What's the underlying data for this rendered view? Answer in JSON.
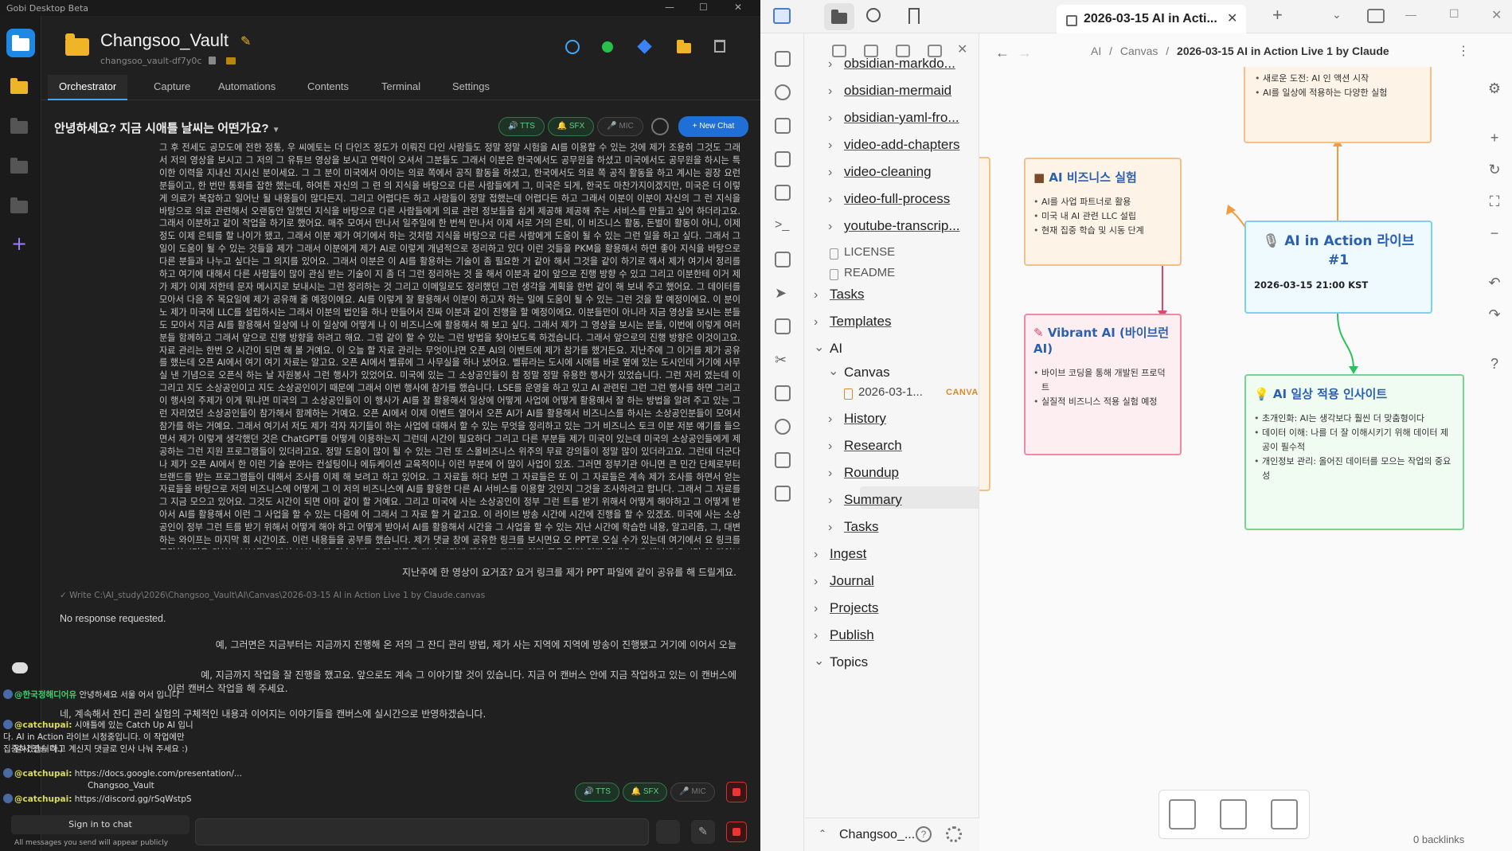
{
  "gobi": {
    "window_title": "Gobi Desktop Beta",
    "vault_name": "Changsoo_Vault",
    "vault_id": "changsoo_vault-df7y0c",
    "tabs": [
      "Orchestrator",
      "Capture",
      "Automations",
      "Contents",
      "Terminal",
      "Settings"
    ],
    "chat_title": "안녕하세요? 지금 시애틀 날씨는 어떤가요?",
    "pills": {
      "tts": "TTS",
      "sfx": "SFX",
      "mic": "MIC",
      "new_chat": "+ New Chat"
    },
    "transcript": "그 후 전세도 공모도에 전한 정통, 우 씨에토는 더 다인즈 정도가 이뤄진 다인 사람들도 정말 정말 시험을 AI를 이용할 수 있는 것에 제가 조용히 그것도 그래서 저의 영상을 보시고 그 저의 그 유튜브 영상을 보시고 연락이 오셔서 그분들도 그래서 이분은 한국에서도 공무원을 하셨고 미국에서도 공무원을 하시는 특이한 이력을 지내신 지시신 분이세요. 그 그 분이 미국에서 아이는 의료 쪽에서 공직 활동을 하셨고, 한국에서도 의료 쪽 공직 활동을 하고 계시는 굉장 요런 분들이고, 한 번만 통화를 잡한 했는데, 하여튼 자신의 그 련 의 지식을 바탕으로 다른 사람들에게 그, 미국은 되게, 한국도 마찬가지이겠지만, 미국은 더 이렇게 의료가 복잡하고 일어난 될 내용들이 많다든지. 그리고 어렵다든 하고 사람들이 정말 접했는데 어렵다든 하고 그래서 이분이 이분이 자신의 그 런 지식을 바탕으로 의료 관련해서 오랜동안 일했던 지식을 바탕으로 다른 사람들에게 의료 관련 정보들을 쉽게 제공해 제공해 주는 서비스를 만들고 싶어 하더라고요. 그래서 이분하고 같이 작업을 하기로 했어요. 매주 모여서 만나서 일주일에 한 번씩 만나서 이제 서로 거의 은퇴, 이 비즈니스 활동, 돈벌이 활동이 아니, 이제 정도 이제 은퇴를 할 나이가 됐고, 그래서 이분 제가 여기에서 하는 것처럼 지식을 바탕으로 다른 사람에게 도움이 될 수 있는 그런 일을 하고 싶다. 그래서 그 일이 도움이 될 수 있는 것들을 제가 그래서 이분에게 제가 AI로 이렇게 개념적으로 정리하고 있다 이런 것들을 PKM을 활용해서 하면 좋아 지식을 바탕으로 다른 분들과 나누고 싶다는 그 의지를 있어요. 그래서 이분은 이 AI를 활용하는 기술이 좀 필요한 거 같아 해서 그것을 같이 하기로 해서 제가 여기서 정리를 하고 여기에 대해서 다른 사람들이 많이 관심 받는 기술이 지 좀 더 그런 정리하는 것 을 해서 이분과 같이 앞으로 진행 방향 수 있고 그리고 이분한테 이거 제가 제가 이제 저한테 문자 메시지로 보내시는 그런 정리하는 것 그리고 이메일로도 정리했던 그런 생각을 계획을 한번 같이 해 보내 주고 했어요. 그 데이터를 모아서 다음 주 목요일에 제가 공유해 줄 예정이에요. AI를 이렇게 잘 활용해서 이분이 하고자 하는 일에 도움이 될 수 있는 그런 것을 할 예정이에요. 이 분이 노 제가 미국에 LLC를 설립하시는 그래서 이분의 법인을 하나 만들어서 진짜 이분과 같이 진행을 할 예정이에요. 이분들만이 아니라 지금 영상을 보시는 분들도 모아서 지금 AI를 활용해서 일상에 나 이 일상에 어떻게 나 이 비즈니스에 활용해서 해 보고 싶다. 그래서 제가 그 영상을 보시는 분들, 이번에 이렇게 여러분들 함께하고 그래서 앞으로 진행 방향을 하려고 해요. 그럼 같이 할 수 있는 그런 방법을 찾아보도록 하겠습니다. 그래서 앞으로의 진행 방향은 이것이고요. 자료 관리는 한번 오 시간이 되면 해 볼 거예요. 이 오늘 할 자료 관리는 무엇이냐면 오픈 AI의 이벤트에 제가 참가를 했거든요. 지난주에 그 이거를 제가 공유를 했는데 오픈 AI에서 여기 여기 자료는 알고요. 오픈 AI에서 벨류에 그 사무실을 하나 냈어요. 벨류라는 도시에 시애틀 바로 옆에 있는 도시인데 거기에 사무실 낸 기념으로 오픈식 하는 날 자원봉사 그런 행사가 있었어요. 미국에 있는 그 소상공인들이 참 정말 정말 유용한 행사가 있었습니다. 그런 자리 였는데 이 그리고 지도 소상공인이고 지도 소상공인이기 때문에 그래서 이번 행사에 참가를 했습니다. LSE를 운영을 하고 있고 AI 관련된 그런 그런 행사를 하면 그리고 이 행사의 주제가 이게 뭐냐면 미국의 그 소상공인들이 이 행사가 AI를 잘 활용해서 일상에 어떻게 사업에 어떻게 활용해서 잘 하는 방법을 알려 주고 있는 그런 자리였던 소상공인들이 참가해서 함께하는 거예요. 오픈 AI에서 이제 이벤트 열어서 오픈 AI가 AI를 활용해서 비즈니스를 하시는 소상공인분들이 모여서 참가를 하는 거예요. 그래서 여기서 저도 제가 각자 자기들이 하는 사업에 대해서 할 수 있는 무엇을 정리하고 있는 그거 비즈니스 토크 이분 저분 얘기를 들으면서 제가 이렇게 생각했던 것은 ChatGPT를 어떻게 이용하는지 그런데 시간이 필요하다 그리고 다른 부분들 제가 미국이 있는데 미국의 소상공인들에게 제공하는 그런 지원 프로그램들이 있더라고요. 정말 도움이 많이 될 수 있는 그런 또 스몰비즈니스 위주의 무료 강의들이 정말 많이 있더라고요. 그런데 더군다나 제가 오픈 AI에서 한 이런 기술 분야는 컨설팅이나 에듀케이션 교육적이나 이런 부분에 어 많이 사업이 있죠. 그러면 정부기관 아니면 큰 민간 단체로부터 브랜드를 받는 프로그램들이 대해서 조사를 이제 해 보려고 하고 있어요. 그 자료들 하다 보면 그 자료들은 또 이 그 자료들은 계속 제가 조사를 하면서 얻는 자료들을 바탕으로 저의 비즈니스에 어떻게 그 이 저의 비즈니스에 AI를 활용한 다른 AI 서비스를 이용할 것인지 그것을 조사하려고 합니다. 그래서 그 자료를 그 지금 모으고 있어요. 그것도 시간이 되면 아마 같이 할 거예요. 그리고 미국에 사는 소상공인이 정부 그런 트를 받기 위해서 어떻게 해야하고 그 어떻게 받아서 AI를 활용해서 이런 그 사업을 할 수 있는 다음에 어 그래서 그 자료 할 거 같고요. 이 라이브 방송 시간에 시간에 진행을 할 수 있겠죠. 미국에 사는 소상공인이 정부 그런 트를 받기 위해서 어떻게 해야 하고 어떻게 받아서 AI를 활용해서 시간을 그 사업을 할 수 있는 지난 시간에 학습한 내용, 알고리즘, 그, 대변하는 와이프는 마지막 회 시간이죠. 이런 내용들을 공부를 했습니다. 제가 댓글 창에 공유한 링크를 보시면요 오 PPT로 오실 수가 있는데 여기에서 요 링크를 클릭하시면은 원하는 부분들을 가서 보실 수가 있습니다. 요런 것들을 지난 시간에 했어요. 그리고 여기 글은 걸려 있지 않네요. 제 채널에 오시면 이 라이브 영상 보실 수가 있으니까 아까 보셨듯이 링크가 안 걸려 있네요. 그러면 제 동영상 유튜브 채널로 오세요",
    "msg_ppt": "지난주에 한 영상이 요거죠? 요거 링크를 제가 PPT 파일에 같이 공유를 해 드릴게요.",
    "write_line": "✓ Write  C:\\AI_study\\2026\\Changsoo_Vault\\AI\\Canvas\\2026-03-15 AI in Action Live 1 by Claude.canvas",
    "no_response": "No response requested.",
    "msg_1": "예, 그러면은 지금부터는 지금까지 진행해 온 저의 그 잔디 관리 방법, 제가 사는 지역에 지역에 방송이 진행됐고 거기에 이어서 오늘",
    "msg_2a": "예, 지금까지 작업을 잘 진행을 했고요. 앞으로도 계속 그 이야기할 것이 있습니다. 지금 어 캔버스 안에 지금 작업하고 있는 이 캔버스에",
    "msg_2b": "이런 캔버스 작업을 해 주세요.",
    "msg_3": "네, 계속해서 잔디 관리 실험의 구체적인 내용과 이어지는 이야기들을 캔버스에 실시간으로 반영하겠습니다.",
    "chat_log": [
      {
        "user": "@한국정해디어유",
        "text": "안녕하세요 서울 어서 입니다"
      },
      {
        "user": "@catchupai:",
        "text": "시애틀에 있는 Catch Up AI 입니다. AI in Action 라이브 시청중입니다. 이 작업에만 집중하겠습니다.)"
      },
      {
        "user": "",
        "text": "일시 전송 하고 계신지 댓글로 인사 나눠 주세요 :)"
      },
      {
        "user": "@catchupai:",
        "text": "https://docs.google.com/presentation/..."
      },
      {
        "user": "",
        "text": "Changsoo_Vault"
      },
      {
        "user": "@catchupai:",
        "text": "https://discord.gg/rSqWstpS"
      }
    ],
    "sign_in": "Sign in to chat",
    "public_note": "All messages you send will appear publicly"
  },
  "obsidian": {
    "tab_title": "2026-03-15 AI in Acti...",
    "breadcrumb": [
      "AI",
      "Canvas",
      "2026-03-15 AI in Action Live 1 by Claude"
    ],
    "tree": [
      {
        "label": "obsidian-markdo...",
        "type": "folder"
      },
      {
        "label": "obsidian-mermaid",
        "type": "folder"
      },
      {
        "label": "obsidian-yaml-fro...",
        "type": "folder"
      },
      {
        "label": "video-add-chapters",
        "type": "folder"
      },
      {
        "label": "video-cleaning",
        "type": "folder"
      },
      {
        "label": "video-full-process",
        "type": "folder"
      },
      {
        "label": "youtube-transcrip...",
        "type": "folder"
      },
      {
        "label": "LICENSE",
        "type": "file"
      },
      {
        "label": "README",
        "type": "file"
      },
      {
        "label": "Tasks",
        "type": "folder"
      },
      {
        "label": "Templates",
        "type": "folder"
      },
      {
        "label": "AI",
        "type": "folder-open"
      },
      {
        "label": "Canvas",
        "type": "folder-open"
      },
      {
        "label": "2026-03-1...",
        "type": "canvas",
        "badge": "CANVAS"
      },
      {
        "label": "History",
        "type": "folder"
      },
      {
        "label": "Research",
        "type": "folder"
      },
      {
        "label": "Roundup",
        "type": "folder"
      },
      {
        "label": "Summary",
        "type": "folder"
      },
      {
        "label": "Tasks",
        "type": "folder"
      },
      {
        "label": "Ingest",
        "type": "folder"
      },
      {
        "label": "Journal",
        "type": "folder"
      },
      {
        "label": "Projects",
        "type": "folder"
      },
      {
        "label": "Publish",
        "type": "folder"
      },
      {
        "label": "Topics",
        "type": "folder-open"
      }
    ],
    "vault_switch": "Changsoo_...",
    "backlinks": "0 backlinks",
    "cards": {
      "top": {
        "items": [
          "새로운 도전: AI 인 액션 시작",
          "AI를 일상에 적용하는 다양한 실험"
        ]
      },
      "business": {
        "title": "AI 비즈니스 실험",
        "items": [
          "AI를 사업 파트너로 활용",
          "미국 내 AI 관련 LLC 설립",
          "현재 집중 학습 및 시동 단계"
        ]
      },
      "vibrant": {
        "title": "Vibrant AI (바이브런 AI)",
        "items": [
          "바이브 코딩을 통해 개발된 프로덕트",
          "실질적 비즈니스 적용 실험 예정"
        ]
      },
      "main": {
        "title": "AI in Action 라이브 #1",
        "date": "2026-03-15 21:00 KST"
      },
      "insight": {
        "title": "AI 일상 적용 인사이트",
        "items": [
          "초개인화: AI는 생각보다 훨씬 더 맞춤형이다",
          "데이터 이해: 나를 더 잘 이해시키기 위해 데이터 제공이 필수적",
          "개인정보 관리: 올어진 데이터를 모으는 작업의 중요성"
        ]
      }
    },
    "colors": {
      "orange": "#f3c08a",
      "red": "#f08aa4",
      "cyan": "#7cd2ee",
      "green": "#7ad38e",
      "accent": "#2b5fb0"
    }
  }
}
